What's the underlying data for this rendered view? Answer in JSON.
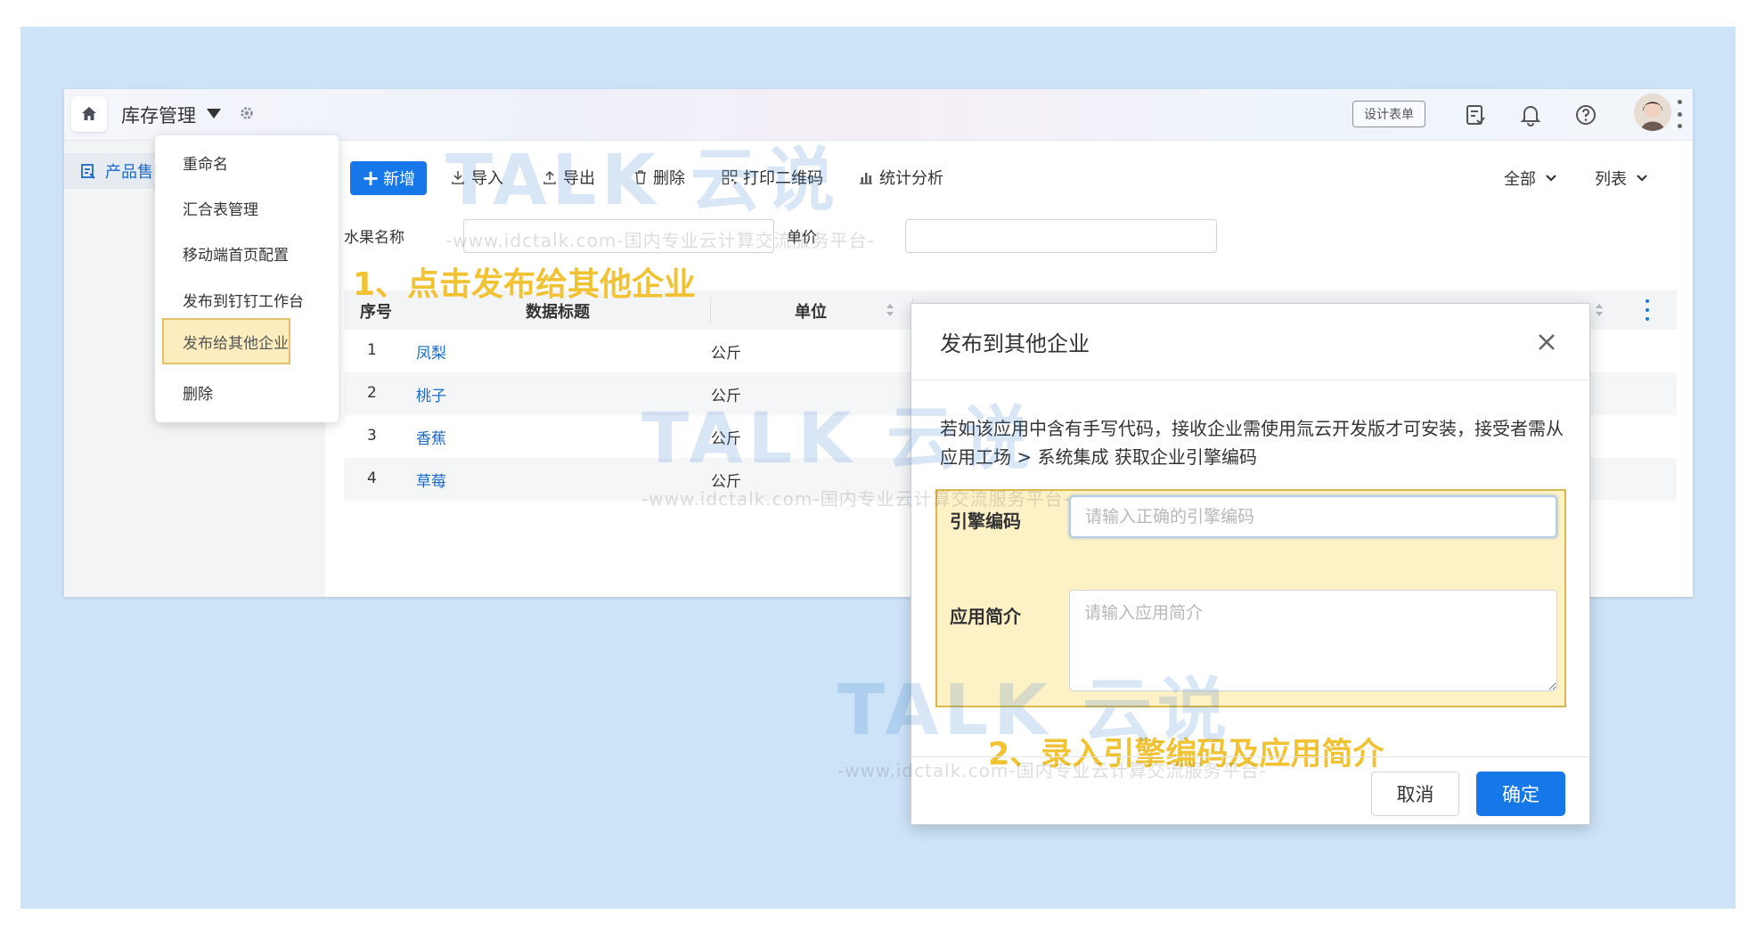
{
  "header": {
    "app_title": "库存管理",
    "design_form_label": "设计表单"
  },
  "sidebar": {
    "items": [
      {
        "label": "产品售"
      }
    ]
  },
  "app_menu": {
    "items": [
      {
        "label": "重命名"
      },
      {
        "label": "汇合表管理"
      },
      {
        "label": "移动端首页配置"
      },
      {
        "label": "发布到钉钉工作台"
      },
      {
        "label": "发布给其他企业",
        "highlighted": true
      },
      {
        "label": "删除"
      }
    ]
  },
  "toolbar": {
    "new_label": "新增",
    "import_label": "导入",
    "export_label": "导出",
    "delete_label": "删除",
    "print_qr_label": "打印二维码",
    "stats_label": "统计分析",
    "scope_select": "全部",
    "view_select": "列表"
  },
  "filters": {
    "fruit_name_label": "水果名称",
    "fruit_name_value": "",
    "unit_price_label": "单价",
    "unit_price_value": ""
  },
  "table": {
    "columns": [
      "序号",
      "数据标题",
      "单位"
    ],
    "rows": [
      {
        "index": "1",
        "title": "凤梨",
        "unit": "公斤"
      },
      {
        "index": "2",
        "title": "桃子",
        "unit": "公斤"
      },
      {
        "index": "3",
        "title": "香蕉",
        "unit": "公斤"
      },
      {
        "index": "4",
        "title": "草莓",
        "unit": "公斤"
      }
    ]
  },
  "annotations": {
    "step1": "1、点击发布给其他企业",
    "step2": "2、录入引擎编码及应用简介"
  },
  "watermark": {
    "logo_text": "TALK 云说",
    "url_text": "-www.idctalk.com-国内专业云计算交流服务平台-"
  },
  "dialog": {
    "title": "发布到其他企业",
    "description": "若如该应用中含有手写代码，接收企业需使用氚云开发版才可安装，接受者需从 应用工场 > 系统集成 获取企业引擎编码",
    "engine_code_label": "引擎编码",
    "engine_code_placeholder": "请输入正确的引擎编码",
    "engine_code_value": "",
    "app_intro_label": "应用简介",
    "app_intro_placeholder": "请输入应用简介",
    "app_intro_value": "",
    "cancel_label": "取消",
    "confirm_label": "确定"
  },
  "colors": {
    "primary": "#1677e8",
    "link": "#1b6ac9",
    "annotation": "#f1c232",
    "highlight_bg": "#fdf1c6",
    "highlight_border": "#d9b94e",
    "page_bg": "#cde4f8"
  }
}
